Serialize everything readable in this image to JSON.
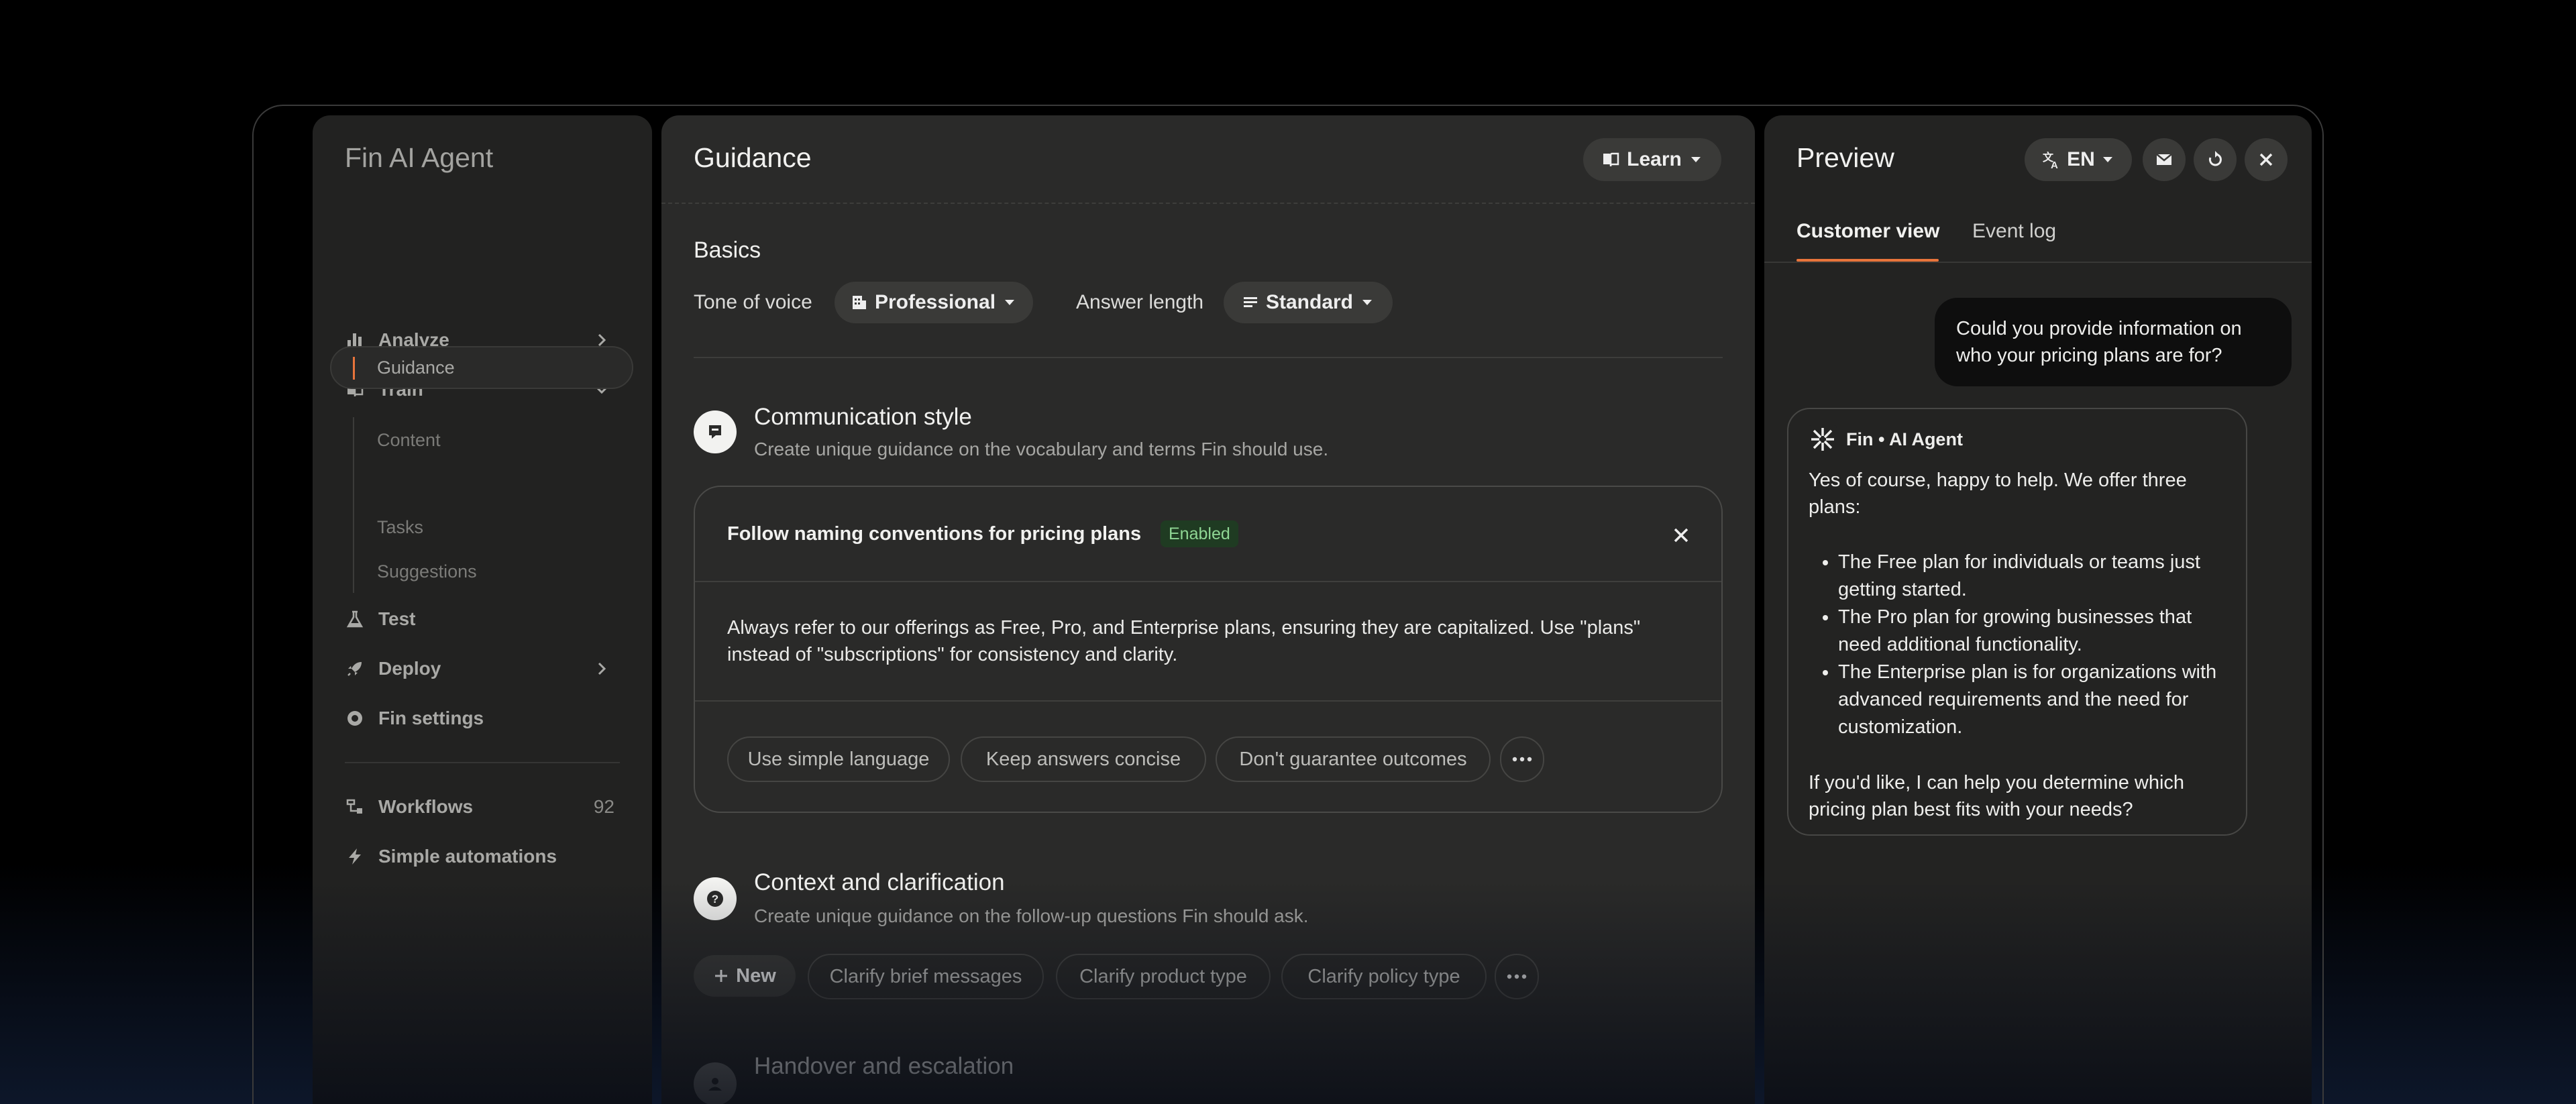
{
  "sidebar": {
    "title": "Fin AI Agent",
    "items": [
      {
        "label": "Analyze"
      },
      {
        "label": "Train"
      },
      {
        "label": "Test"
      },
      {
        "label": "Deploy"
      },
      {
        "label": "Fin settings"
      }
    ],
    "train_sub": [
      "Content",
      "Guidance",
      "Tasks",
      "Suggestions"
    ],
    "workflows": {
      "label": "Workflows",
      "count": "92"
    },
    "simple_automations": "Simple automations"
  },
  "guidance": {
    "title": "Guidance",
    "learn_label": "Learn",
    "basics": {
      "title": "Basics",
      "tone_label": "Tone of voice",
      "tone_value": "Professional",
      "length_label": "Answer length",
      "length_value": "Standard"
    },
    "communication": {
      "title": "Communication style",
      "desc": "Create unique guidance on the vocabulary and terms Fin should use.",
      "card": {
        "title": "Follow naming conventions for pricing plans",
        "badge": "Enabled",
        "body": "Always refer to our offerings as Free, Pro, and Enterprise plans, ensuring they are capitalized. Use \"plans\" instead of \"subscriptions\" for consistency and clarity.",
        "chips": [
          "Use simple language",
          "Keep answers concise",
          "Don't guarantee outcomes"
        ]
      }
    },
    "context": {
      "title": "Context and clarification",
      "desc": "Create unique guidance on the follow-up questions Fin should ask.",
      "new_label": "New",
      "chips": [
        "Clarify brief messages",
        "Clarify product type",
        "Clarify policy type"
      ]
    },
    "handover": {
      "title": "Handover and escalation"
    }
  },
  "preview": {
    "title": "Preview",
    "lang": "EN",
    "tabs": [
      "Customer view",
      "Event log"
    ],
    "user_message": "Could you provide information on who your pricing plans are for?",
    "bot": {
      "name": "Fin • AI Agent",
      "intro": "Yes of course, happy to help. We offer three plans:",
      "list": [
        "The Free plan for individuals or teams just getting started.",
        "The Pro plan for growing businesses that need additional functionality.",
        "The Enterprise plan is for organizations with advanced requirements and the need for customization."
      ],
      "outro": "If you'd like, I can help you determine which pricing plan best fits with your needs?"
    }
  },
  "colors": {
    "accent": "#e8743b",
    "enabled_badge": "#8fd694"
  }
}
